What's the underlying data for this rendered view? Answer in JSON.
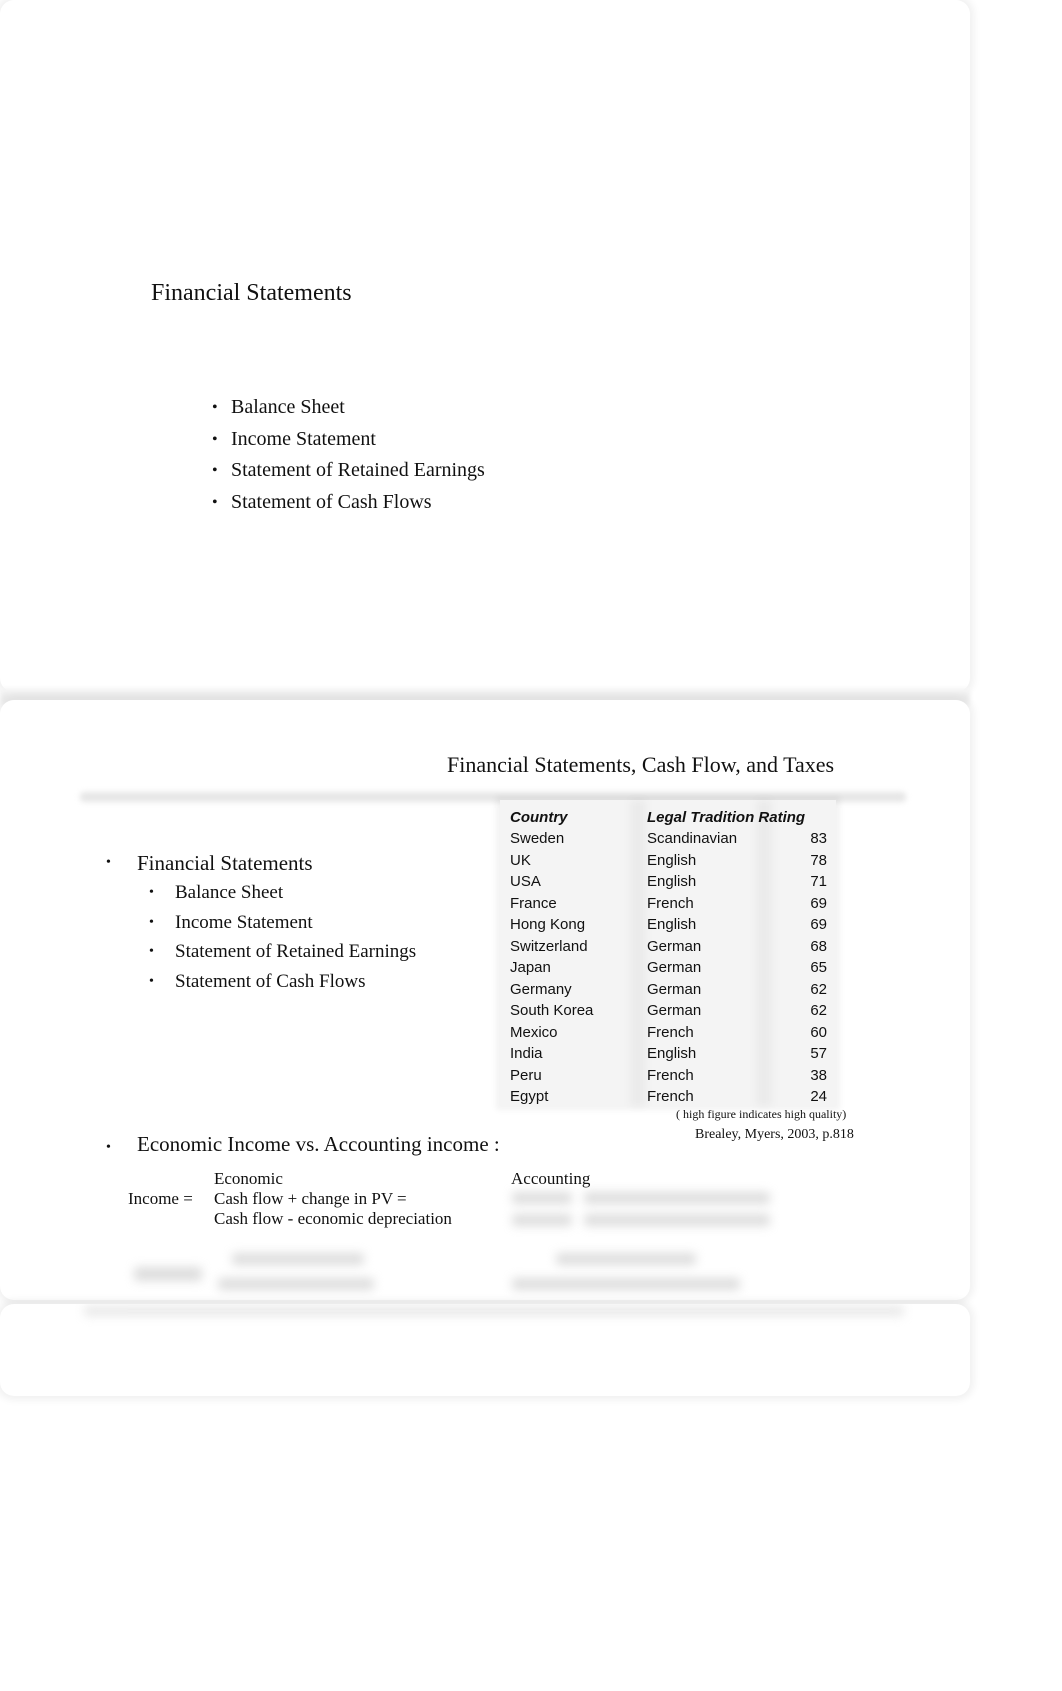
{
  "slide1": {
    "title": "Financial Statements",
    "bullet_glyph": "•",
    "items": [
      "Balance Sheet",
      "Income Statement",
      "Statement of Retained Earnings",
      "Statement of Cash Flows"
    ]
  },
  "slide2": {
    "title": "Financial Statements, Cash Flow, and Taxes",
    "bullet_glyph": "•",
    "main_bullet": "Financial Statements",
    "sub_items": [
      "Balance Sheet",
      "Income Statement",
      "Statement of Retained Earnings",
      "Statement of Cash Flows"
    ],
    "table": {
      "headers": [
        "Country",
        "Legal Tradition",
        "Rating"
      ],
      "rows": [
        [
          "Sweden",
          "Scandinavian",
          "83"
        ],
        [
          "UK",
          "English",
          "78"
        ],
        [
          "USA",
          "English",
          "71"
        ],
        [
          "France",
          "French",
          "69"
        ],
        [
          "Hong Kong",
          "English",
          "69"
        ],
        [
          "Switzerland",
          "German",
          "68"
        ],
        [
          "Japan",
          "German",
          "65"
        ],
        [
          "Germany",
          "German",
          "62"
        ],
        [
          "South Korea",
          "German",
          "62"
        ],
        [
          "Mexico",
          "French",
          "60"
        ],
        [
          "India",
          "English",
          "57"
        ],
        [
          "Peru",
          "French",
          "38"
        ],
        [
          "Egypt",
          "French",
          "24"
        ]
      ],
      "note": "( high figure indicates high quality)",
      "source": "Brealey, Myers, 2003, p.818"
    },
    "second_bullet": "Economic Income vs. Accounting income :",
    "income": {
      "label": "Income =",
      "economic_heading": "Economic",
      "economic_lines": [
        "Cash flow + change in PV =",
        "Cash flow - economic depreciation"
      ],
      "accounting_heading": "Accounting"
    }
  }
}
